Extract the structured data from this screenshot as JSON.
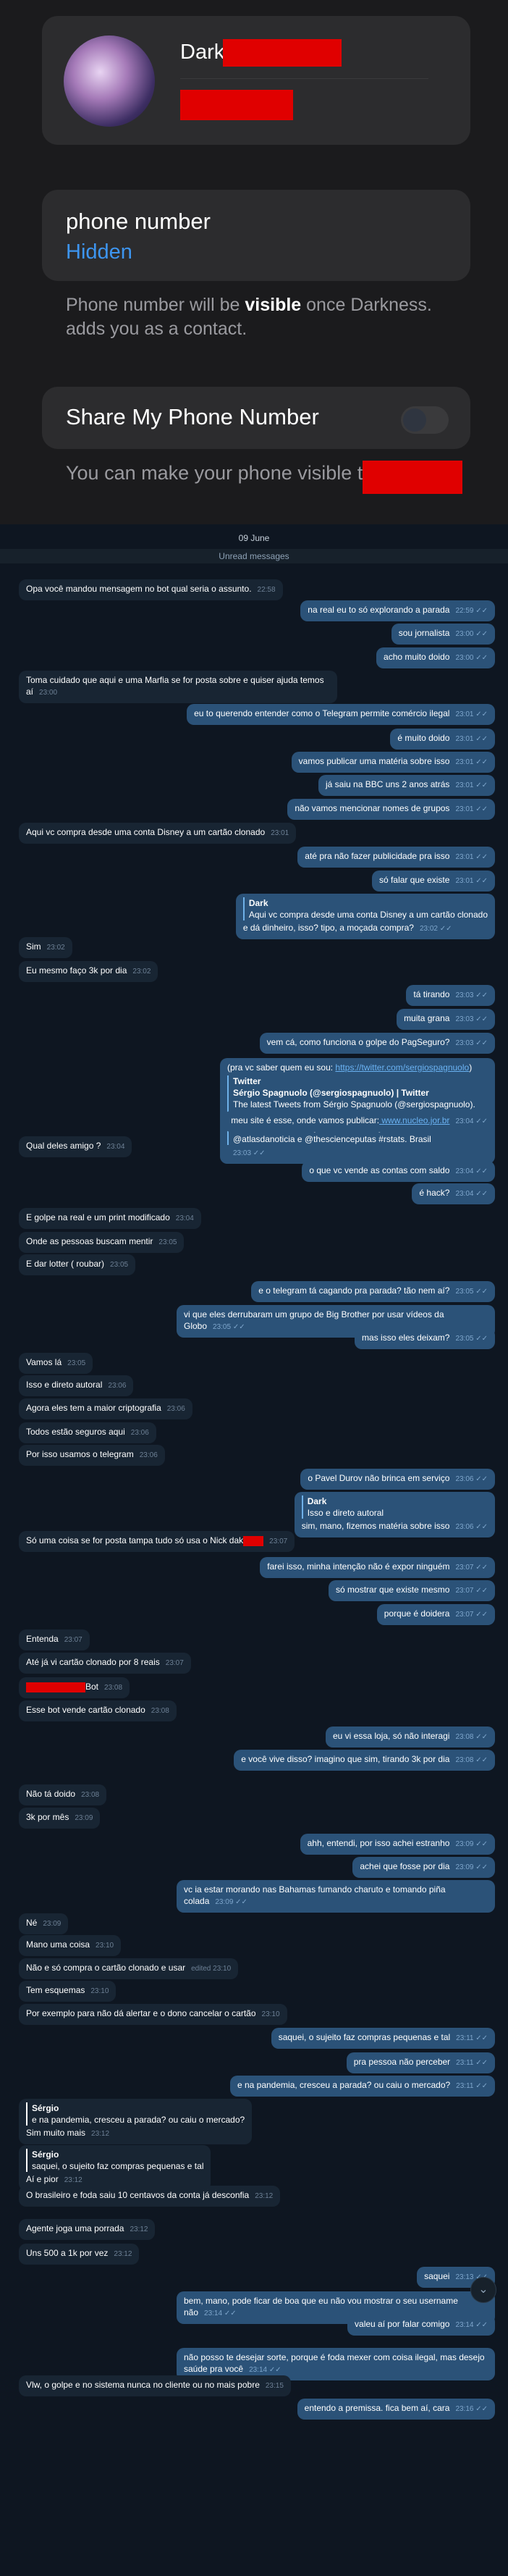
{
  "profile": {
    "name": "Dark",
    "phone_label": "phone number",
    "phone_value": "Hidden",
    "note_prefix": "Phone number will be",
    "note_bold": "visible",
    "note_suffix": "once Darkness. adds you as a contact.",
    "share_title": "Share My Phone Number",
    "share_note": "You can make your phone visible to"
  },
  "chat": {
    "date": "09 June",
    "unread": "Unread messages"
  },
  "messages": [
    {
      "dir": "in",
      "text": "Opa você mandou mensagem no bot qual seria o assunto.",
      "time": "22:58"
    },
    {
      "dir": "out",
      "text": "na real eu to só explorando a parada",
      "time": "22:59 ✓✓"
    },
    {
      "dir": "out",
      "text": "sou jornalista",
      "time": "23:00 ✓✓"
    },
    {
      "dir": "out",
      "text": "acho muito doido",
      "time": "23:00 ✓✓"
    },
    {
      "dir": "in",
      "text": "Toma cuidado que aqui e uma Marfia se for posta sobre e quiser ajuda temos aí",
      "time": "23:00"
    },
    {
      "dir": "out",
      "text": "eu to querendo entender como o Telegram permite comércio ilegal",
      "time": "23:01 ✓✓"
    },
    {
      "dir": "out",
      "text": "é muito doido",
      "time": "23:01 ✓✓"
    },
    {
      "dir": "out",
      "text": "vamos publicar uma matéria sobre isso",
      "time": "23:01 ✓✓"
    },
    {
      "dir": "out",
      "text": "já saiu na BBC uns 2 anos atrás",
      "time": "23:01 ✓✓"
    },
    {
      "dir": "out",
      "text": "não vamos mencionar nomes de grupos",
      "time": "23:01 ✓✓"
    },
    {
      "dir": "in",
      "text": "Aqui vc compra desde uma conta Disney a um cartão clonado",
      "time": "23:01"
    },
    {
      "dir": "out",
      "text": "até pra não fazer publicidade pra isso",
      "time": "23:01 ✓✓"
    },
    {
      "dir": "out",
      "text": "só falar que existe",
      "time": "23:01 ✓✓"
    },
    {
      "dir": "out",
      "quote_name": "Dark",
      "quote": "Aqui vc compra desde uma conta Disney a um cartão clonado",
      "text": "e dá dinheiro, isso? tipo, a moçada compra?",
      "time": "23:02 ✓✓"
    },
    {
      "dir": "in",
      "text": "Sim",
      "time": "23:02"
    },
    {
      "dir": "in",
      "text": "Eu mesmo faço 3k por dia",
      "time": "23:02"
    },
    {
      "dir": "out",
      "text": "tá tirando",
      "time": "23:03 ✓✓"
    },
    {
      "dir": "out",
      "text": "muita grana",
      "time": "23:03 ✓✓"
    },
    {
      "dir": "out",
      "text": "vem cá, como funciona o golpe do PagSeguro?",
      "time": "23:03 ✓✓"
    },
    {
      "dir": "out",
      "link_prefix": "(pra vc saber quem eu sou:",
      "link": "https://twitter.com/sergiospagnuolo",
      "link_suffix": ")",
      "card_src": "Twitter",
      "card_title": "Sérgio Spagnuolo (@sergiospagnuolo) | Twitter",
      "card_desc": "The latest Tweets from Sérgio Spagnuolo (@sergiospagnuolo). investigo o impacto das redes sociais @nucleojor. fellow @ICFJ, consultor @volddataljb. diretor @abraji. coordenador @atlasdanoticia e @thescienceputas #rstats. Brasil",
      "time": "23:03 ✓✓"
    },
    {
      "dir": "out",
      "text": "meu site é esse, onde vamos publicar:",
      "link": "www.nucleo.jor.br",
      "time": "23:04 ✓✓"
    },
    {
      "dir": "in",
      "text": "Qual deles amigo ?",
      "time": "23:04"
    },
    {
      "dir": "out",
      "text": "o que vc vende as contas com saldo",
      "time": "23:04 ✓✓"
    },
    {
      "dir": "out",
      "text": "é hack?",
      "time": "23:04 ✓✓"
    },
    {
      "dir": "in",
      "text": "E golpe na real e um print modificado",
      "time": "23:04"
    },
    {
      "dir": "in",
      "text": "Onde as pessoas buscam mentir",
      "time": "23:05"
    },
    {
      "dir": "in",
      "text": "E dar lotter ( roubar)",
      "time": "23:05"
    },
    {
      "dir": "out",
      "text": "e o telegram tá cagando pra parada? tão nem aí?",
      "time": "23:05 ✓✓"
    },
    {
      "dir": "out",
      "text": "vi que eles derrubaram um grupo de Big Brother por usar vídeos da Globo",
      "time": "23:05 ✓✓"
    },
    {
      "dir": "out",
      "text": "mas isso eles deixam?",
      "time": "23:05 ✓✓"
    },
    {
      "dir": "in",
      "text": "Vamos lá",
      "time": "23:05"
    },
    {
      "dir": "in",
      "text": "Isso e direto autoral",
      "time": "23:06"
    },
    {
      "dir": "in",
      "text": "Agora eles tem a maior criptografia",
      "time": "23:06"
    },
    {
      "dir": "in",
      "text": "Todos estão seguros aqui",
      "time": "23:06"
    },
    {
      "dir": "in",
      "text": "Por isso usamos o telegram",
      "time": "23:06"
    },
    {
      "dir": "out",
      "text": "o Pavel Durov não brinca em serviço",
      "time": "23:06 ✓✓"
    },
    {
      "dir": "out",
      "quote_name": "Dark",
      "quote": "Isso e direto autoral",
      "text": "sim, mano, fizemos matéria sobre isso",
      "time": "23:06 ✓✓"
    },
    {
      "dir": "in",
      "text": "Só uma coisa se for posta tampa tudo só usa o Nick dak",
      "time": "23:07"
    },
    {
      "dir": "out",
      "text": "farei isso, minha intenção não é expor ninguém",
      "time": "23:07 ✓✓"
    },
    {
      "dir": "out",
      "text": "só mostrar que existe mesmo",
      "time": "23:07 ✓✓"
    },
    {
      "dir": "out",
      "text": "porque é doidera",
      "time": "23:07 ✓✓"
    },
    {
      "dir": "in",
      "text": "Entenda",
      "time": "23:07"
    },
    {
      "dir": "in",
      "text": "Até já vi cartão clonado por 8 reais",
      "time": "23:07"
    },
    {
      "dir": "in",
      "text": "Bot",
      "time": "23:08"
    },
    {
      "dir": "in",
      "text": "Esse bot vende cartão clonado",
      "time": "23:08"
    },
    {
      "dir": "out",
      "text": "eu vi essa loja, só não interagi",
      "time": "23:08 ✓✓"
    },
    {
      "dir": "out",
      "text": "e você vive disso? imagino que sim, tirando 3k por dia",
      "time": "23:08 ✓✓"
    },
    {
      "dir": "in",
      "text": "Não tá doido",
      "time": "23:08"
    },
    {
      "dir": "in",
      "text": "3k por mês",
      "time": "23:09"
    },
    {
      "dir": "out",
      "text": "ahh, entendi, por isso achei estranho",
      "time": "23:09 ✓✓"
    },
    {
      "dir": "out",
      "text": "achei que fosse por dia",
      "time": "23:09 ✓✓"
    },
    {
      "dir": "out",
      "text": "vc ia estar morando nas Bahamas fumando charuto e tomando piña colada",
      "time": "23:09 ✓✓"
    },
    {
      "dir": "in",
      "text": "Né",
      "time": "23:09"
    },
    {
      "dir": "in",
      "text": "Mano uma coisa",
      "time": "23:10"
    },
    {
      "dir": "in",
      "text": "Não e só compra o cartão clonado e usar",
      "time": "edited 23:10"
    },
    {
      "dir": "in",
      "text": "Tem esquemas",
      "time": "23:10"
    },
    {
      "dir": "in",
      "text": "Por exemplo para não dá alertar e o dono cancelar o cartão",
      "time": "23:10"
    },
    {
      "dir": "out",
      "text": "saquei, o sujeito faz compras pequenas e tal",
      "time": "23:11 ✓✓"
    },
    {
      "dir": "out",
      "text": "pra pessoa não perceber",
      "time": "23:11 ✓✓"
    },
    {
      "dir": "out",
      "text": "e na pandemia, cresceu a parada? ou caiu o mercado?",
      "time": "23:11 ✓✓"
    },
    {
      "dir": "in",
      "quote_name": "Sérgio",
      "quote": "e na pandemia, cresceu a parada? ou caiu o mercado?",
      "text": "Sim muito mais",
      "time": "23:12"
    },
    {
      "dir": "in",
      "quote_name": "Sérgio",
      "quote": "saquei, o sujeito faz compras pequenas e tal",
      "text": "Aí e pior",
      "time": "23:12"
    },
    {
      "dir": "in",
      "text": "O brasileiro e foda saiu 10 centavos da conta já desconfia",
      "time": "23:12"
    },
    {
      "dir": "in",
      "text": "Agente joga uma porrada",
      "time": "23:12"
    },
    {
      "dir": "in",
      "text": "Uns 500 a 1k por vez",
      "time": "23:12"
    },
    {
      "dir": "out",
      "text": "saquei",
      "time": "23:13 ✓✓"
    },
    {
      "dir": "out",
      "text": "bem, mano, pode ficar de boa que eu não vou mostrar o seu username não",
      "time": "23:14 ✓✓"
    },
    {
      "dir": "out",
      "text": "valeu aí por falar comigo",
      "time": "23:14 ✓✓"
    },
    {
      "dir": "out",
      "text": "não posso te desejar sorte, porque é foda mexer com coisa ilegal, mas desejo saúde pra você",
      "time": "23:14 ✓✓"
    },
    {
      "dir": "in",
      "text": "Vlw, o golpe e no sistema nunca no cliente ou no mais pobre",
      "time": "23:15"
    },
    {
      "dir": "out",
      "text": "entendo a premissa. fica bem aí, cara",
      "time": "23:16 ✓✓"
    }
  ]
}
